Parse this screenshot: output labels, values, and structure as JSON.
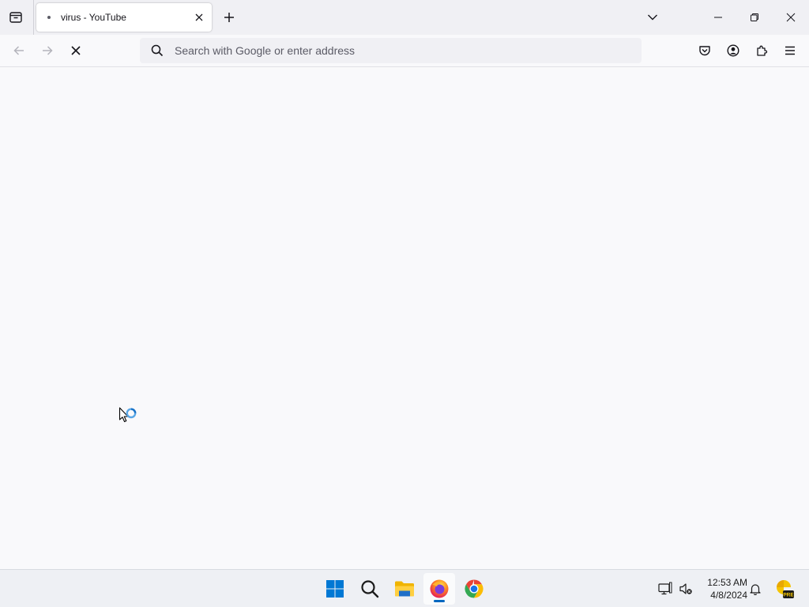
{
  "tabs": [
    {
      "title": "virus - YouTube"
    }
  ],
  "urlbar": {
    "placeholder": "Search with Google or enter address",
    "value": ""
  },
  "taskbar": {
    "apps": [
      {
        "name": "Start",
        "icon": "windows-start-icon"
      },
      {
        "name": "Search",
        "icon": "search-icon"
      },
      {
        "name": "File Explorer",
        "icon": "folder-icon"
      },
      {
        "name": "Firefox",
        "icon": "firefox-icon",
        "active": true
      },
      {
        "name": "Google Chrome",
        "icon": "chrome-icon"
      }
    ],
    "clock": {
      "time": "12:53 AM",
      "date": "4/8/2024"
    },
    "badge": "PRE"
  },
  "colors": {
    "tabstrip": "#f0f0f4",
    "content": "#f9f9fb",
    "accent": "#0067c0"
  }
}
